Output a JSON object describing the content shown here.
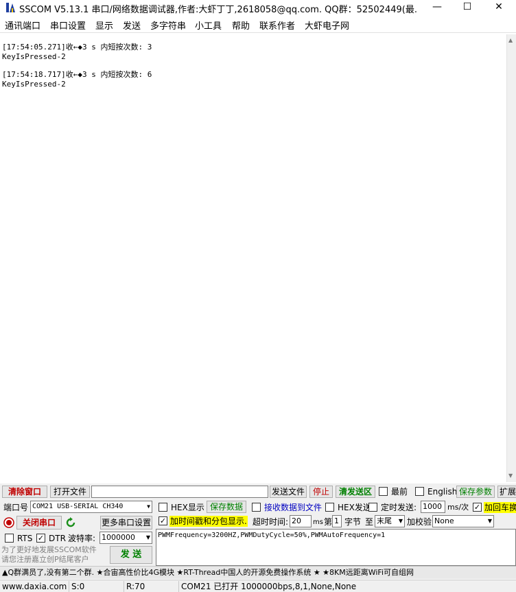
{
  "window": {
    "title": "SSCOM V5.13.1 串口/网络数据调试器,作者:大虾丁丁,2618058@qq.com. QQ群：52502449(最...",
    "minimize_glyph": "—",
    "maximize_glyph": "☐",
    "close_glyph": "✕"
  },
  "menu": [
    "通讯端口",
    "串口设置",
    "显示",
    "发送",
    "多字符串",
    "小工具",
    "帮助",
    "联系作者",
    "大虾电子网"
  ],
  "receive": {
    "lines": [
      "[17:54:05.271]收←◆3 s 内短按次数: 3",
      "KeyIsPressed-2",
      "",
      "[17:54:18.717]收←◆3 s 内短按次数: 6",
      "KeyIsPressed-2"
    ]
  },
  "toolbar": {
    "clear_window": "清除窗口",
    "open_file": "打开文件",
    "file_path": "",
    "send_file": "发送文件",
    "stop": "停止",
    "clear_send": "清发送区",
    "topmost": "最前",
    "english": "English",
    "save_params": "保存参数",
    "expand": "扩展"
  },
  "port": {
    "port_label": "端口号",
    "port_value": "COM21 USB-SERIAL CH340",
    "close_port": "关闭串口",
    "more_settings": "更多串口设置",
    "rts": "RTS",
    "dtr": "DTR",
    "baud_label": "波特率:",
    "baud_value": "1000000",
    "promo1": "为了更好地发展SSCOM软件",
    "promo2": "请您注册嘉立创P结尾客户",
    "send_button": "发 送"
  },
  "options": {
    "hex_display": "HEX显示",
    "save_data": "保存数据",
    "recv_to_file": "接收数据到文件",
    "hex_send": "HEX发送",
    "timed_send": "定时发送:",
    "interval_value": "1000",
    "interval_unit": "ms/次",
    "add_crlf": "加回车换",
    "timestamp": "加时间戳和分包显示.",
    "timeout_label": "超时时间:",
    "timeout_value": "20",
    "timeout_unit": "ms",
    "nth_label": "第",
    "nth_value": "1",
    "byte_label": "字节",
    "to_label": "至",
    "to_value": "末尾",
    "checksum_label": "加校验",
    "checksum_value": "None"
  },
  "send_text": "PWMFrequency=3200HZ,PWMDutyCycle=50%,PWMAutoFrequency=1",
  "ad_text": "▲Q群满员了,没有第二个群. ★合宙高性价比4G模块 ★RT-Thread中国人的开源免费操作系统 ★ ★8KM远距离WiFi可自组网",
  "status": {
    "website": "www.daxia.com",
    "sent": "S:0",
    "received": "R:70",
    "port_state": "COM21 已打开  1000000bps,8,1,None,None"
  },
  "colors": {
    "accent_red": "#c00000",
    "accent_green": "#008000",
    "accent_blue": "#0000c0",
    "highlight_yellow": "#ffff00"
  }
}
